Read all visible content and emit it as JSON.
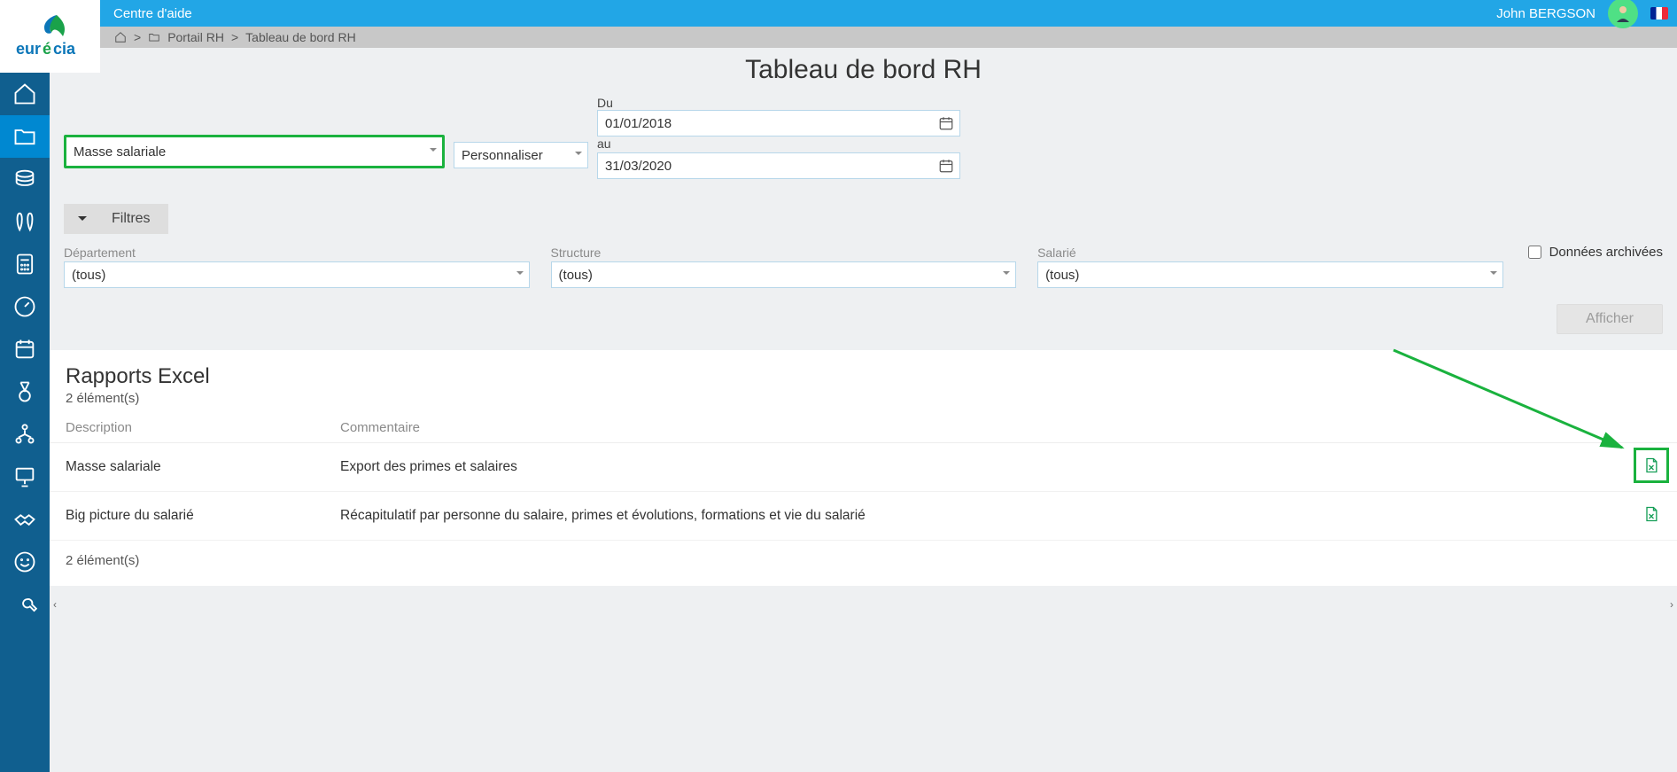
{
  "topbar": {
    "help": "Centre d'aide",
    "user": "John  BERGSON"
  },
  "breadcrumb": {
    "item1": "Portail RH",
    "item2": "Tableau de bord RH"
  },
  "page": {
    "title": "Tableau de bord RH"
  },
  "period": {
    "from_label": "Du",
    "to_label": "au",
    "from": "01/01/2018",
    "to": "31/03/2020"
  },
  "selectors": {
    "type": "Masse salariale",
    "mode": "Personnaliser"
  },
  "filters": {
    "toggle": "Filtres",
    "dept_label": "Département",
    "struct_label": "Structure",
    "emp_label": "Salarié",
    "all": "(tous)",
    "archived": "Données archivées"
  },
  "actions": {
    "show": "Afficher"
  },
  "reports": {
    "title": "Rapports Excel",
    "count_top": "2 élément(s)",
    "count_bottom": "2 élément(s)",
    "col_desc": "Description",
    "col_comment": "Commentaire",
    "rows": [
      {
        "desc": "Masse salariale",
        "comment": "Export des primes et salaires"
      },
      {
        "desc": "Big picture du salarié",
        "comment": "Récapitulatif par personne du salaire, primes et évolutions, formations et vie du salarié"
      }
    ]
  }
}
